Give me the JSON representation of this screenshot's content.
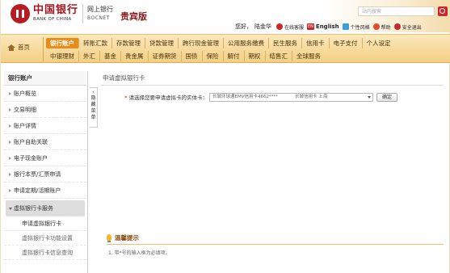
{
  "header": {
    "logo_cn": "中国银行",
    "logo_en": "BANK OF CHINA",
    "logo_sub_cn": "网上银行",
    "logo_sub_en": "BOCNET",
    "vip_label": "贵宾版",
    "search_placeholder": "站内搜索",
    "greeting": "您好，",
    "user_name": "陆金华",
    "links": {
      "online_service": "在线客服",
      "english": "English",
      "english_tag": "EN",
      "style": "个性风格",
      "help": "帮助",
      "logout": "安全退出"
    }
  },
  "nav": {
    "home": "首页",
    "row1": [
      "银行账户",
      "转账汇款",
      "存款管理",
      "贷款管理",
      "跨行现金管理",
      "公用服务缴费",
      "民生服务",
      "信用卡",
      "电子支付",
      "个人设定"
    ],
    "row2": [
      "中银理财",
      "外汇",
      "基金",
      "贵金属",
      "证券期货",
      "国债",
      "保险",
      "解付",
      "期权",
      "结售汇",
      "全球服务"
    ],
    "active": "银行账户"
  },
  "sidebar": {
    "title": "银行账户",
    "items": [
      "账户概览",
      "交易明细",
      "账户详情",
      "账户自助关联",
      "电子现金账户",
      "银行本票/汇票申请",
      "申请定期/活期账户"
    ],
    "open_item": "虚拟银行卡服务",
    "sub_items": [
      "申请虚拟银行卡",
      "虚拟银行卡功能设置",
      "虚拟银行卡信息查询"
    ],
    "collapse_label": "隐藏菜单"
  },
  "main": {
    "title": "申请虚拟银行卡",
    "form": {
      "required_mark": "*",
      "label": "请选择您要申请虚拟卡的实体卡：",
      "card_name": "长城环球通EMV信用卡4662****",
      "card_region": "长城信用卡 上海",
      "confirm": "确定"
    },
    "tips": {
      "title": "温馨提示",
      "text": "1. 带*号的输入框为必填项。"
    }
  },
  "colors": {
    "brand_red": "#b81c22",
    "nav_active": "#e98b16",
    "nav_bg": "#f3cf84"
  }
}
